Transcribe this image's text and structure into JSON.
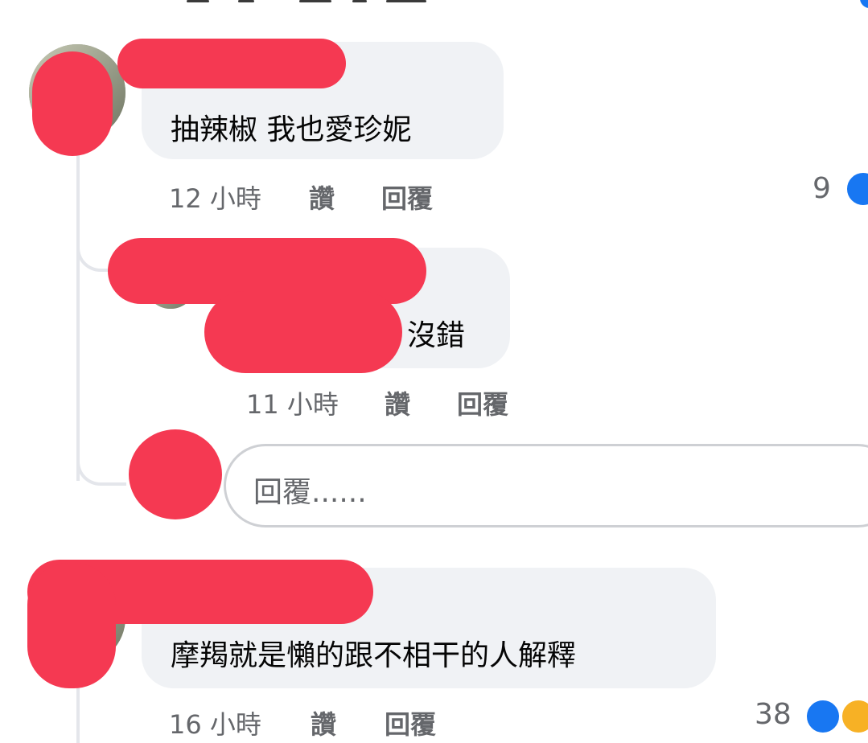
{
  "comments": [
    {
      "text": "抽辣椒 我也愛珍妮",
      "time": "12 小時",
      "like_label": "讚",
      "reply_label": "回覆",
      "reaction_count": "9"
    },
    {
      "text": "沒錯",
      "time": "11 小時",
      "like_label": "讚",
      "reply_label": "回覆"
    },
    {
      "text": "摩羯就是懶的跟不相干的人解釋",
      "time": "16 小時",
      "like_label": "讚",
      "reply_label": "回覆",
      "reaction_count": "38"
    }
  ],
  "reply_input": {
    "placeholder": "回覆......"
  },
  "colors": {
    "bubble": "#f0f2f5",
    "meta_text": "#65676b",
    "like_blue": "#1877f2",
    "haha_yellow": "#f7b125",
    "redaction": "#f53952"
  }
}
